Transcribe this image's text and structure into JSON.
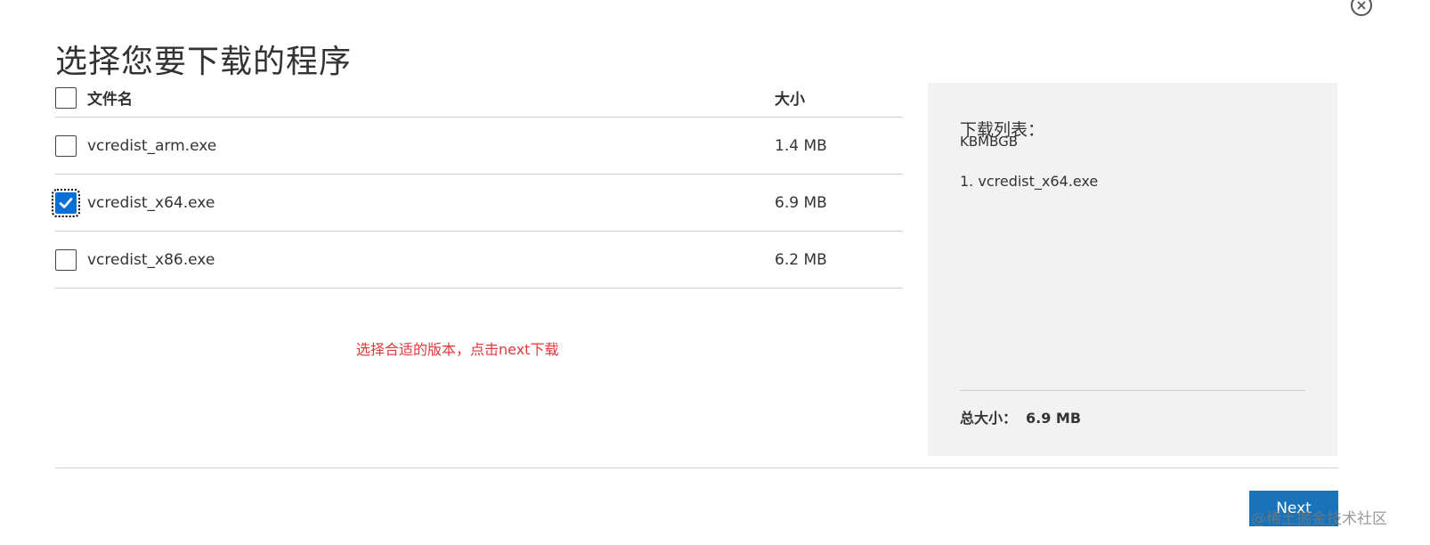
{
  "dialog": {
    "title": "选择您要下载的程序",
    "close_icon": "close-icon"
  },
  "table": {
    "header": {
      "name": "文件名",
      "size": "大小",
      "checked": false
    },
    "rows": [
      {
        "name": "vcredist_arm.exe",
        "size": "1.4 MB",
        "checked": false
      },
      {
        "name": "vcredist_x64.exe",
        "size": "6.9 MB",
        "checked": true
      },
      {
        "name": "vcredist_x86.exe",
        "size": "6.2 MB",
        "checked": false
      }
    ]
  },
  "annotation": "选择合适的版本，点击next下载",
  "side": {
    "title": "下载列表：",
    "subtitle": "KBMBGB",
    "items": [
      "1. vcredist_x64.exe"
    ],
    "total_label": "总大小：",
    "total_value": "6.9 MB"
  },
  "footer": {
    "next_label": "Next",
    "watermark": "@稀土掘金技术社区"
  },
  "colors": {
    "accent": "#1a73b8",
    "checkbox_checked": "#0b6fd8",
    "annotation": "#e03a3a",
    "panel_bg": "#f2f2f2"
  }
}
